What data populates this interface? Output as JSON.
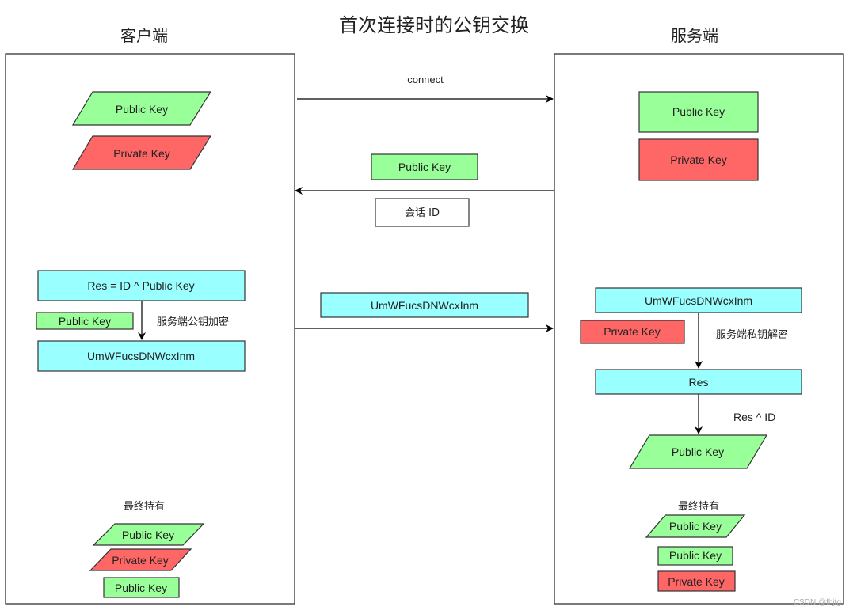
{
  "title": "首次连接时的公钥交换",
  "colors": {
    "public_key": "#99ff99",
    "private_key": "#ff6666",
    "cipher": "#99ffff",
    "border": "#333333"
  },
  "client": {
    "label": "客户端",
    "initial_keys": {
      "public": "Public  Key",
      "private": "Private  Key"
    },
    "res_formula": "Res = ID ^ Public Key",
    "server_public_key": "Public  Key",
    "encrypt_label": "服务端公钥加密",
    "ciphertext": "UmWFucsDNWcxInm",
    "final_label": "最终持有",
    "final_keys": [
      "Public  Key",
      "Private  Key",
      "Public  Key"
    ]
  },
  "server": {
    "label": "服务端",
    "initial_keys": {
      "public": "Public  Key",
      "private": "Private  Key"
    },
    "ciphertext": "UmWFucsDNWcxInm",
    "private_key": "Private  Key",
    "decrypt_label": "服务端私钥解密",
    "res": "Res",
    "xor_label": "Res ^ ID",
    "recovered_key": "Public  Key",
    "final_label": "最终持有",
    "final_keys": [
      "Public  Key",
      "Public  Key",
      "Private  Key"
    ]
  },
  "messages": {
    "connect": "connect",
    "server_public_key": "Public  Key",
    "session_id": "会话 ID",
    "ciphertext": "UmWFucsDNWcxInm"
  },
  "watermark": "CSDN @fhjtg"
}
